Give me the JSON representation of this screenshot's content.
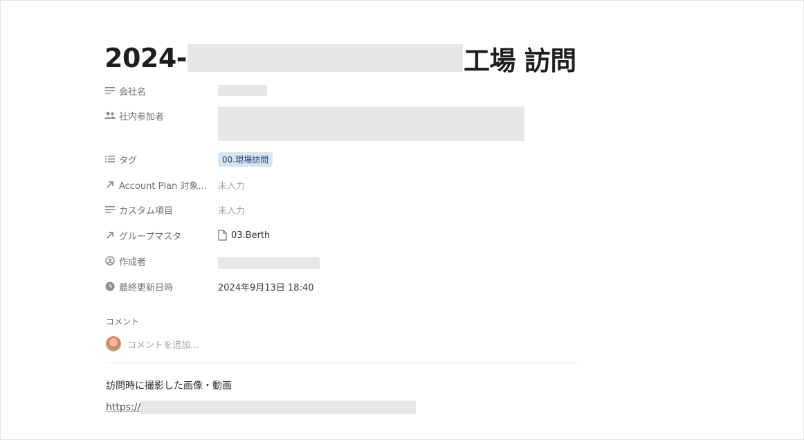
{
  "page": {
    "title_prefix": "2024-",
    "title_suffix": "工場 訪問"
  },
  "properties": {
    "company": {
      "label": "会社名",
      "icon": "text-lines-icon"
    },
    "participants": {
      "label": "社内参加者",
      "icon": "people-icon"
    },
    "tags": {
      "label": "タグ",
      "icon": "list-icon",
      "value": "00.現場訪問"
    },
    "account_plan": {
      "label": "Account Plan 対象...",
      "icon": "relation-arrow-icon",
      "value": "未入力"
    },
    "custom_item": {
      "label": "カスタム項目",
      "icon": "text-lines-icon",
      "value": "未入力"
    },
    "group_master": {
      "label": "グループマスタ",
      "icon": "relation-arrow-icon",
      "value": "03.Berth"
    },
    "created_by": {
      "label": "作成者",
      "icon": "person-circle-icon"
    },
    "last_edited": {
      "label": "最終更新日時",
      "icon": "clock-icon",
      "value": "2024年9月13日 18:40"
    }
  },
  "comments": {
    "heading": "コメント",
    "placeholder": "コメントを追加..."
  },
  "content": {
    "paragraph": "訪問時に撮影した画像・動画",
    "link_prefix": "https://"
  },
  "colors": {
    "tag_bg": "#d8e4f4",
    "redaction": "#e6e6e6"
  }
}
